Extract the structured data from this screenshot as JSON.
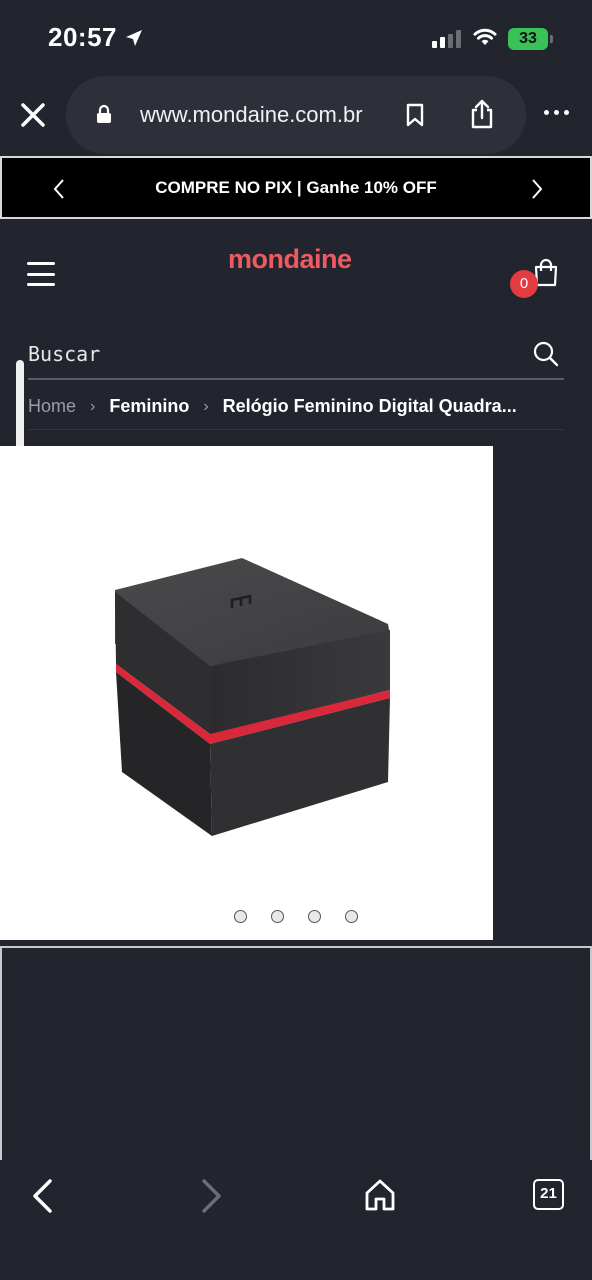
{
  "status_bar": {
    "time": "20:57",
    "battery": "33"
  },
  "browser": {
    "url": "www.mondaine.com.br",
    "tabs_count": "21"
  },
  "promo": {
    "text": "COMPRE NO PIX | Ganhe 10% OFF"
  },
  "header": {
    "logo": "mondaine",
    "cart_count": "0"
  },
  "search": {
    "placeholder": "Buscar"
  },
  "breadcrumb": {
    "home": "Home",
    "category": "Feminino",
    "current": "Relógio Feminino Digital Quadra..."
  },
  "gallery": {
    "slide_count": 4
  },
  "colors": {
    "background": "#23252e",
    "brand": "#ee5a63",
    "badge": "#e23c40",
    "battery": "#39c25a"
  },
  "icons": [
    "location-arrow-icon",
    "signal-icon",
    "wifi-icon",
    "close-icon",
    "lock-icon",
    "bookmark-icon",
    "share-icon",
    "more-icon",
    "chevron-left-icon",
    "chevron-right-icon",
    "menu-icon",
    "cart-icon",
    "search-icon",
    "back-icon",
    "forward-icon",
    "home-icon",
    "tabs-icon"
  ]
}
